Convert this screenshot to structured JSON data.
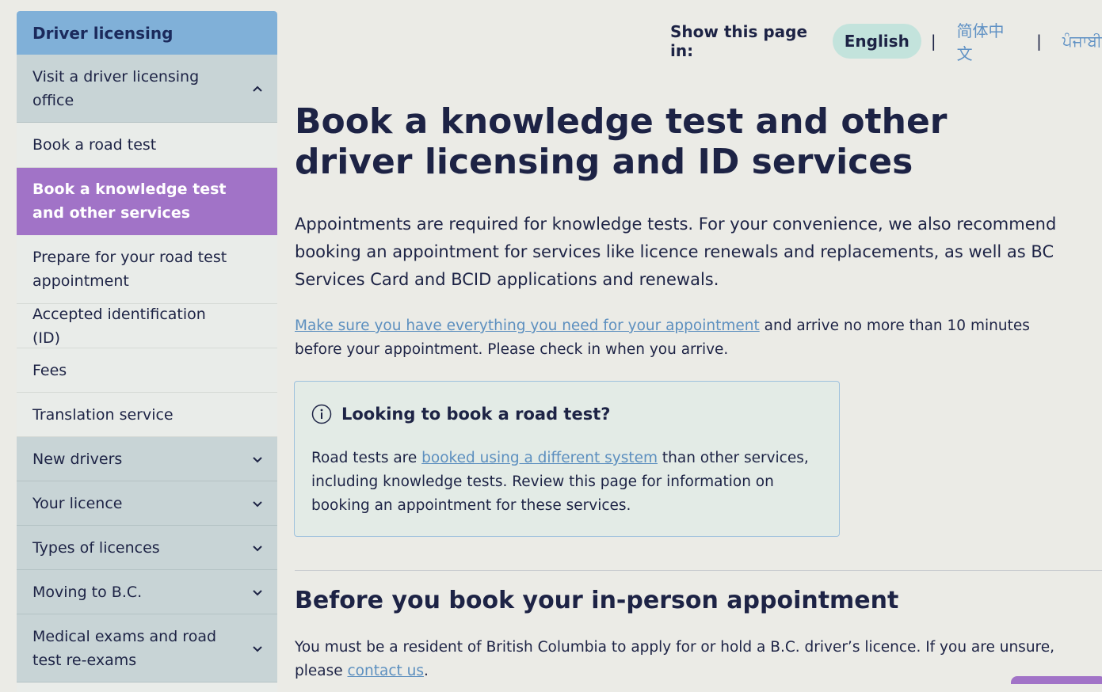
{
  "sidebar": {
    "header": "Driver licensing",
    "items": [
      {
        "label": "Visit a driver licensing office",
        "type": "section",
        "chevron": "chevron-up"
      },
      {
        "label": "Book a road test",
        "type": "child"
      },
      {
        "label": "Book a knowledge test and other services",
        "type": "active"
      },
      {
        "label": "Prepare for your road test appointment",
        "type": "child"
      },
      {
        "label": "Accepted identification (ID)",
        "type": "child"
      },
      {
        "label": "Fees",
        "type": "child"
      },
      {
        "label": "Translation service",
        "type": "child"
      },
      {
        "label": "New drivers",
        "type": "section",
        "chevron": "chevron-down"
      },
      {
        "label": "Your licence",
        "type": "section",
        "chevron": "chevron-down"
      },
      {
        "label": "Types of licences",
        "type": "section",
        "chevron": "chevron-down"
      },
      {
        "label": "Moving to B.C.",
        "type": "section",
        "chevron": "chevron-down"
      },
      {
        "label": "Medical exams and road test re-exams",
        "type": "section",
        "chevron": "chevron-down"
      }
    ]
  },
  "language": {
    "label": "Show this page in:",
    "selected": "English",
    "separator": "|",
    "options": [
      "简体中文",
      "ਪੰਜਾਬੀ"
    ]
  },
  "main": {
    "title": "Book a knowledge test and other driver licensing and ID services",
    "intro": "Appointments are required for knowledge tests. For your convenience, we also recommend booking an appointment for services like licence renewals and replacements, as well as BC Services Card and BCID applications and renewals.",
    "para2_link": "Make sure you have everything you need for your appointment",
    "para2_rest": " and arrive no more than 10 minutes before your appointment. Please check in when you arrive.",
    "callout": {
      "title": "Looking to book a road test?",
      "body_pre": "Road tests are ",
      "body_link": "booked using a different system",
      "body_post": " than other services, including knowledge tests. Review this page for information on booking an appointment for these services."
    },
    "section_title": "Before you book your in-person appointment",
    "resident_pre": "You must be a resident of British Columbia to apply for or hold a B.C. driver’s licence.  If you are unsure, please ",
    "resident_link": "contact us",
    "resident_post": "."
  },
  "colors": {
    "accent_purple": "#a173c7",
    "header_blue": "#80b0d8",
    "link_blue": "#5c8fbf",
    "text_navy": "#1d2345",
    "pill_teal": "#c3e3dc"
  }
}
